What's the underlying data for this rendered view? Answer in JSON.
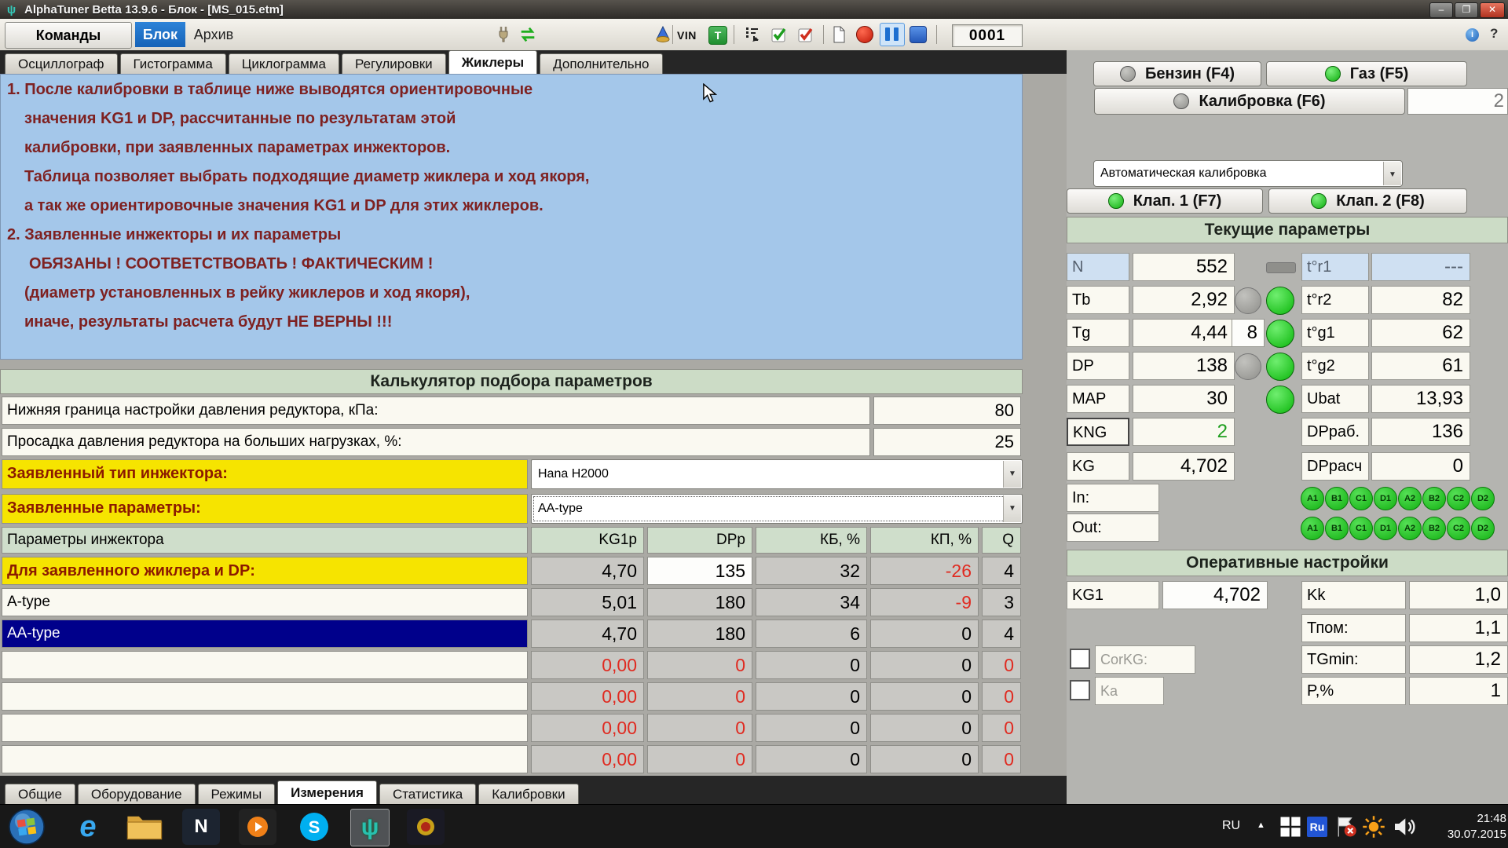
{
  "window": {
    "title": "AlphaTuner Betta 13.9.6 - Блок - [MS_015.etm]"
  },
  "menubar": {
    "items": [
      {
        "label": "Команды"
      },
      {
        "label": "Блок",
        "active": true
      },
      {
        "label": "Архив"
      }
    ]
  },
  "toolbar": {
    "vin_label": "VIN",
    "t_label": "T",
    "counter": "0001"
  },
  "tabs_top": {
    "items": [
      {
        "label": "Осциллограф",
        "active": false
      },
      {
        "label": "Гистограмма",
        "active": false
      },
      {
        "label": "Циклограмма",
        "active": false
      },
      {
        "label": "Регулировки",
        "active": false
      },
      {
        "label": "Жиклеры",
        "active": true
      },
      {
        "label": "Дополнительно",
        "active": false
      }
    ]
  },
  "tabs_bottom": {
    "items": [
      {
        "label": "Общие",
        "active": false
      },
      {
        "label": "Оборудование",
        "active": false
      },
      {
        "label": "Режимы",
        "active": false
      },
      {
        "label": "Измерения",
        "active": true
      },
      {
        "label": "Статистика",
        "active": false
      },
      {
        "label": "Калибровки",
        "active": false
      }
    ]
  },
  "info": {
    "lines": [
      {
        "text": "1. После калибровки в таблице ниже выводятся ориентировочные",
        "indent": 0
      },
      {
        "text": "значения  KG1  и  DP, рассчитанные  по  результатам этой",
        "indent": 1
      },
      {
        "text": "калибровки, при заявленных параметрах инжекторов.",
        "indent": 1
      },
      {
        "text": "Таблица  позволяет  выбрать  подходящие  диаметр жиклера и ход якоря,",
        "indent": 1
      },
      {
        "text": "а так же ориентировочные значения  KG1 и DP для этих жиклеров.",
        "indent": 1
      },
      {
        "text": "2. Заявленные инжекторы и их параметры",
        "indent": 0
      },
      {
        "text": "ОБЯЗАНЫ ! СООТВЕТСТВОВАТЬ ! ФАКТИЧЕСКИМ !",
        "indent": 2
      },
      {
        "text": "(диаметр установленных в рейку жиклеров и ход якоря),",
        "indent": 1
      },
      {
        "text": "иначе, результаты расчета будут НЕ ВЕРНЫ !!!",
        "indent": 1
      }
    ]
  },
  "calc": {
    "title": "Калькулятор подбора параметров",
    "p_label": "Нижняя граница настройки давления редуктора, кПа:",
    "p_value": "80",
    "d_label": "Просадка давления редуктора на больших нагрузках, %:",
    "d_value": "25",
    "inj_type_label": "Заявленный тип инжектора:",
    "inj_type_value": "Hana H2000",
    "inj_par_label": "Заявленные параметры:",
    "inj_par_value": "AA-type",
    "table": {
      "header_label": "Параметры инжектора",
      "cols": [
        "KG1p",
        "DPp",
        "КБ, %",
        "КП, %",
        "Q"
      ],
      "rows": [
        {
          "style": "declared",
          "label": "Для заявленного жиклера и DP:",
          "kg1p": "4,70",
          "dpp": "135",
          "kb": "32",
          "kp": "-26",
          "q": "4"
        },
        {
          "style": "plain",
          "label": "A-type",
          "kg1p": "5,01",
          "dpp": "180",
          "kb": "34",
          "kp": "-9",
          "q": "3"
        },
        {
          "style": "selected",
          "label": "AA-type",
          "kg1p": "4,70",
          "dpp": "180",
          "kb": "6",
          "kp": "0",
          "q": "4"
        },
        {
          "style": "empty",
          "label": "",
          "kg1p": "0,00",
          "dpp": "0",
          "kb": "0",
          "kp": "0",
          "q": "0"
        },
        {
          "style": "empty",
          "label": "",
          "kg1p": "0,00",
          "dpp": "0",
          "kb": "0",
          "kp": "0",
          "q": "0"
        },
        {
          "style": "empty",
          "label": "",
          "kg1p": "0,00",
          "dpp": "0",
          "kb": "0",
          "kp": "0",
          "q": "0"
        },
        {
          "style": "empty",
          "label": "",
          "kg1p": "0,00",
          "dpp": "0",
          "kb": "0",
          "kp": "0",
          "q": "0"
        }
      ]
    }
  },
  "right": {
    "benzin": "Бензин (F4)",
    "gaz": "Газ  (F5)",
    "kalib": "Калибровка (F6)",
    "kalib_count": "2",
    "mode": "Автоматическая калибровка",
    "klap1": "Клап. 1 (F7)",
    "klap2": "Клап. 2 (F8)",
    "cur_title": "Текущие параметры",
    "params": [
      {
        "p": "N",
        "v": "552",
        "ind": "bar",
        "p2": "t°r1",
        "v2": "---",
        "hl": true
      },
      {
        "p": "Tb",
        "v": "2,92",
        "ind": "graygreen",
        "p2": "t°r2",
        "v2": "82"
      },
      {
        "p": "Tg",
        "v": "4,44",
        "ind": "boxgreen",
        "box": "8",
        "p2": "t°g1",
        "v2": "62"
      },
      {
        "p": "DP",
        "v": "138",
        "ind": "graygreen",
        "p2": "t°g2",
        "v2": "61"
      },
      {
        "p": "MAP",
        "v": "30",
        "ind": "green",
        "p2": "Ubat",
        "v2": "13,93"
      },
      {
        "p": "KNG",
        "v": "2",
        "vgreen": true,
        "focus": true,
        "p2": "DPраб.",
        "v2": "136"
      },
      {
        "p": "KG",
        "v": "4,702",
        "p2": "DPрасч",
        "v2": "0"
      }
    ],
    "in_label": "In:",
    "out_label": "Out:",
    "io_badges": [
      "A1",
      "B1",
      "C1",
      "D1",
      "A2",
      "B2",
      "C2",
      "D2"
    ],
    "oper_title": "Оперативные настройки",
    "kg1_label": "KG1",
    "kg1_value": "4,702",
    "corkg_label": "CorKG:",
    "ka_label": "Ka",
    "oper_rows": [
      {
        "label": "Kk",
        "value": "1,0"
      },
      {
        "label": "Тпом:",
        "value": "1,1"
      },
      {
        "label": "TGmin:",
        "value": "1,2"
      },
      {
        "label": "P,%",
        "value": "1"
      }
    ]
  },
  "taskbar": {
    "lang": "RU",
    "ru_badge": "Ru",
    "time": "21:48",
    "date": "30.07.2015"
  }
}
